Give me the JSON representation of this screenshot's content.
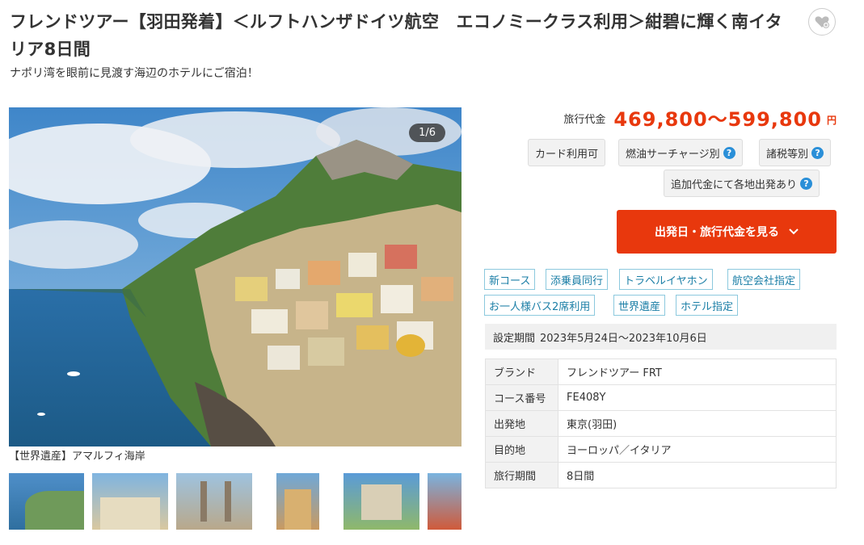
{
  "title": "フレンドツアー【羽田発着】＜ルフトハンザドイツ航空　エコノミークラス利用＞紺碧に輝く南イタリア8日間",
  "subtitle": "ナポリ湾を眼前に見渡す海辺のホテルにご宿泊！",
  "favorite": {
    "icon": "heart-plus-icon"
  },
  "gallery": {
    "counter": "1/6",
    "caption": "【世界遺産】アマルフィ海岸",
    "thumbnails": [
      "Amalfi coast",
      "Alberobello",
      "Pompeii",
      "Amalfi cathedral",
      "Castel del Monte",
      "Sea cliff"
    ]
  },
  "price": {
    "label": "旅行代金",
    "value": "469,800〜599,800",
    "unit": "円"
  },
  "badges": {
    "card": "カード利用可",
    "fuel": "燃油サーチャージ別",
    "tax": "諸税等別",
    "extra": "追加代金にて各地出発あり",
    "help_icon": "question-circle-icon"
  },
  "cta": {
    "label": "出発日・旅行代金を見る",
    "icon": "chevron-down-icon"
  },
  "features": [
    "新コース",
    "添乗員同行",
    "トラベルイヤホン",
    "航空会社指定",
    "お一人様バス2席利用",
    "世界遺産",
    "ホテル指定"
  ],
  "period": {
    "label": "設定期間",
    "value": "2023年5月24日〜2023年10月6日"
  },
  "info_rows": [
    {
      "key": "ブランド",
      "value": "フレンドツアー FRT"
    },
    {
      "key": "コース番号",
      "value": "FE408Y"
    },
    {
      "key": "出発地",
      "value": "東京(羽田)"
    },
    {
      "key": "目的地",
      "value": "ヨーロッパ／イタリア"
    },
    {
      "key": "旅行期間",
      "value": "8日間"
    }
  ],
  "colors": {
    "accent": "#e8380d",
    "chip_text": "#1a7ea6",
    "chip_border": "#8cc9de",
    "help": "#2a8fd8"
  }
}
